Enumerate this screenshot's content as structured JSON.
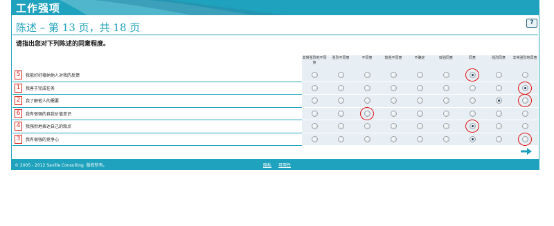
{
  "header": {
    "title": "工作强项"
  },
  "page": {
    "heading": "陈述 – 第 13 页，共 18 页",
    "help_label": "?"
  },
  "instruction": "请指出您对下列陈述的同意程度。",
  "scale": [
    {
      "label": "非常强烈地不同意"
    },
    {
      "label": "强烈不同意"
    },
    {
      "label": "不同意"
    },
    {
      "label": "较强不同意"
    },
    {
      "label": "不确定"
    },
    {
      "label": "较强同意"
    },
    {
      "label": "同意"
    },
    {
      "label": "强烈同意"
    },
    {
      "label": "非常强烈地同意"
    }
  ],
  "rows": [
    {
      "rank": "5",
      "text": "我能好好接纳他人对我的反馈",
      "selected": 6,
      "circled": true
    },
    {
      "rank": "1",
      "text": "我善于完成任务",
      "selected": 8,
      "circled": true
    },
    {
      "rank": "2",
      "text": "我了解他人的需要",
      "selected": 7,
      "circled": true
    },
    {
      "rank": "6",
      "text": "我有很强的自我价值意识",
      "selected": -1,
      "circled": true
    },
    {
      "rank": "4",
      "text": "我强烈地表达自己的观点",
      "selected": 6,
      "circled": true
    },
    {
      "rank": "3",
      "text": "我有很强的竞争心",
      "selected": 6,
      "circled": true
    }
  ],
  "red_circles": [
    {
      "row": 0,
      "col": 6
    },
    {
      "row": 1,
      "col": 8
    },
    {
      "row": 2,
      "col": 8
    },
    {
      "row": 3,
      "col": 2
    },
    {
      "row": 4,
      "col": 6
    },
    {
      "row": 5,
      "col": 8
    }
  ],
  "footer": {
    "copyright": "© 2005 - 2012 Saville Consulting. 版权所有。",
    "link_help": "隐私",
    "link_terms": "可用性"
  },
  "colors": {
    "brand": "#1fa2bd",
    "annotation": "#e01010",
    "grid": "#e7eff4"
  },
  "icons": {
    "next": "arrow-right-icon",
    "help": "help-icon"
  }
}
